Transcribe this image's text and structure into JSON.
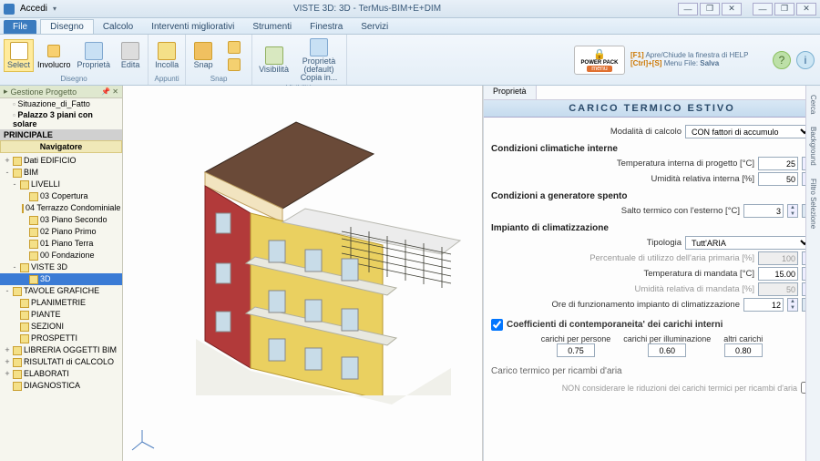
{
  "window": {
    "title": "VISTE 3D: 3D - TerMus-BIM+E+DIM",
    "access_label": "Accedi"
  },
  "win_controls": {
    "min": "—",
    "max_down": "❐",
    "max_up": "❐",
    "close": "✕"
  },
  "ribbon": {
    "file": "File",
    "tabs": [
      "Disegno",
      "Calcolo",
      "Interventi migliorativi",
      "Strumenti",
      "Finestra",
      "Servizi"
    ],
    "active_tab": "Disegno",
    "groups": {
      "select": "Select",
      "involucro": "Involucro",
      "proprieta": "Proprietà",
      "edita": "Edita",
      "incolla": "Incolla",
      "snap": "Snap",
      "visibilita": "Visibilità",
      "prop_default": "Proprietà (default) Copia in...",
      "grp_disegno": "Disegno",
      "grp_appunti": "Appunti",
      "grp_snap": "Snap",
      "grp_visibilita": "Visibilità"
    },
    "powerpack": {
      "label": "POWER PACK",
      "menu": "menu"
    },
    "help": {
      "key1": "[F1]",
      "key2": "[Ctrl]+[S]",
      "line1": "Apre/Chiude la finestra di HELP",
      "line2_a": "Menu File: ",
      "line2_b": "Salva"
    }
  },
  "sidebar": {
    "header": "Gestione Progetto",
    "tabs": [
      "Situazione_di_Fatto",
      "Palazzo 3 piani con solare"
    ],
    "principale": "PRINCIPALE",
    "navigatore": "Navigatore",
    "tree": [
      {
        "l": 0,
        "t": "Dati EDIFICIO",
        "tw": "+"
      },
      {
        "l": 0,
        "t": "BIM",
        "tw": "-"
      },
      {
        "l": 1,
        "t": "LIVELLI",
        "tw": "-"
      },
      {
        "l": 2,
        "t": "03 Copertura"
      },
      {
        "l": 2,
        "t": "04 Terrazzo Condominiale"
      },
      {
        "l": 2,
        "t": "03 Piano Secondo"
      },
      {
        "l": 2,
        "t": "02 Piano Primo"
      },
      {
        "l": 2,
        "t": "01 Piano Terra"
      },
      {
        "l": 2,
        "t": "00 Fondazione"
      },
      {
        "l": 1,
        "t": "VISTE 3D",
        "tw": "-"
      },
      {
        "l": 2,
        "t": "3D",
        "sel": true
      },
      {
        "l": 0,
        "t": "TAVOLE GRAFICHE",
        "tw": "-"
      },
      {
        "l": 1,
        "t": "PLANIMETRIE"
      },
      {
        "l": 1,
        "t": "PIANTE"
      },
      {
        "l": 1,
        "t": "SEZIONI"
      },
      {
        "l": 1,
        "t": "PROSPETTI"
      },
      {
        "l": 0,
        "t": "LIBRERIA OGGETTI BIM",
        "tw": "+"
      },
      {
        "l": 0,
        "t": "RISULTATI di CALCOLO",
        "tw": "+"
      },
      {
        "l": 0,
        "t": "ELABORATI",
        "tw": "+"
      },
      {
        "l": 0,
        "t": "DIAGNOSTICA"
      }
    ]
  },
  "right": {
    "prop_tab": "Proprietà",
    "title": "CARICO  TERMICO  ESTIVO",
    "mod_calc_label": "Modalità di calcolo",
    "mod_calc_value": "CON fattori di accumulo",
    "sect_cond_int": "Condizioni climatiche interne",
    "temp_int_label": "Temperatura interna di progetto [°C]",
    "temp_int_value": "25",
    "umid_int_label": "Umidità relativa interna [%]",
    "umid_int_value": "50",
    "sect_gen_spento": "Condizioni a generatore spento",
    "salto_label": "Salto termico con l'esterno [°C]",
    "salto_value": "3",
    "sect_impianto": "Impianto di climatizzazione",
    "tipologia_label": "Tipologia",
    "tipologia_value": "Tutt'ARIA",
    "perc_aria_label": "Percentuale di utilizzo dell'aria primaria [%]",
    "perc_aria_value": "100",
    "temp_mandata_label": "Temperatura di mandata [°C]",
    "temp_mandata_value": "15.00",
    "umid_mandata_label": "Umidità relativa di mandata [%]",
    "umid_mandata_value": "50",
    "ore_label": "Ore di funzionamento impianto di climatizzazione",
    "ore_value": "12",
    "sect_coeff": "Coefficienti di contemporaneita' dei carichi interni",
    "coef_persone_label": "carichi per persone",
    "coef_persone_value": "0.75",
    "coef_illum_label": "carichi per illuminazione",
    "coef_illum_value": "0.60",
    "coef_altri_label": "altri carichi",
    "coef_altri_value": "0.80",
    "sect_ricambi": "Carico termico per ricambi d'aria",
    "non_cons_label": "NON considerare le riduzioni dei carichi termici per ricambi d'aria"
  },
  "edge": {
    "t1": "Cerca",
    "t2": "Background",
    "t3": "Filtro Selezione"
  }
}
